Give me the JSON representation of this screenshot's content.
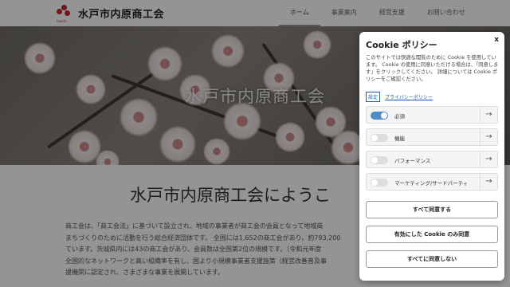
{
  "header": {
    "logo_text": "水戸市内原商工会",
    "logo_subtext": "Inuchi",
    "nav": [
      "ホーム",
      "事業案内",
      "経営支援",
      "お問い合わせ"
    ],
    "active_nav_index": 0
  },
  "hero": {
    "title": "水戸市内原商工会"
  },
  "main": {
    "welcome": "水戸市内原商工会にようこ",
    "paragraph_lines": [
      "商工会は、「商工会法」に基づいて設立され、地域の事業者が商工会の会員となって地域商",
      "まちづくりのために活動を行う総合経済団体です。 全国には1,652の商工会があり、約793,200",
      "ています。茨城県内には43の商工会があり、会員数は全国第2位の規模です。（令和元年度",
      "全国的なネットワークと高い組織率を有し、国より小規模事業者支援施策（経営改善普及事",
      "援機関に認定され、さまざまな事業を展開しています。"
    ]
  },
  "cookie": {
    "title": "Cookie ポリシー",
    "close": "x",
    "description": "このサイトでは快適な閲覧のために Cookie を使用しています。 Cookie の使用に同意いただける場合は、「同意します」をクリックしてください。 詳細については Cookie ポリシーをご確認ください。",
    "settings_link": "設定",
    "privacy_link": "プライバシーポリシー",
    "toggles": [
      {
        "label": "必須",
        "on": true
      },
      {
        "label": "機能",
        "on": false
      },
      {
        "label": "パフォーマンス",
        "on": false
      },
      {
        "label": "マーケティング/サードパーティ",
        "on": false
      }
    ],
    "arrow": "→",
    "accept_all": "すべて同意する",
    "accept_enabled": "有効にした Cookie のみ同意",
    "reject_all": "すべてに同意しない"
  },
  "colors": {
    "accent": "#4f8dc9",
    "logo_red": "#c4262e",
    "link": "#1a5fb4"
  }
}
